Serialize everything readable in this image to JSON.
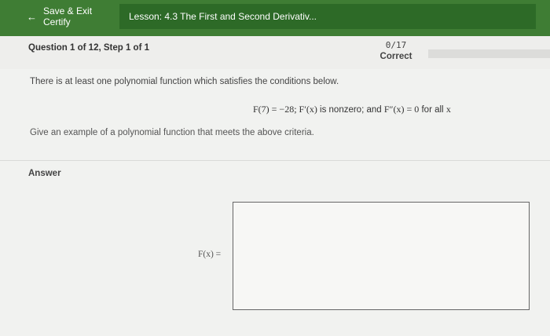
{
  "topbar": {
    "back_label": "Save & Exit Certify",
    "lesson_title": "Lesson: 4.3 The First and Second Derivativ..."
  },
  "question": {
    "title": "Question 1 of 12, Step 1 of 1",
    "score": "0/17",
    "score_status": "Correct"
  },
  "prompt": {
    "intro": "There is at least one polynomial function which satisfies the conditions below.",
    "condition_math_1": "F(7) = −28; F′(x)",
    "condition_text_1": " is nonzero; and ",
    "condition_math_2": "F″(x) = 0",
    "condition_text_2": " for all ",
    "condition_math_3": "x",
    "task": "Give an example of a polynomial function that meets the above criteria."
  },
  "answer": {
    "label": "Answer",
    "field_label": "F(x) =",
    "field_value": ""
  }
}
